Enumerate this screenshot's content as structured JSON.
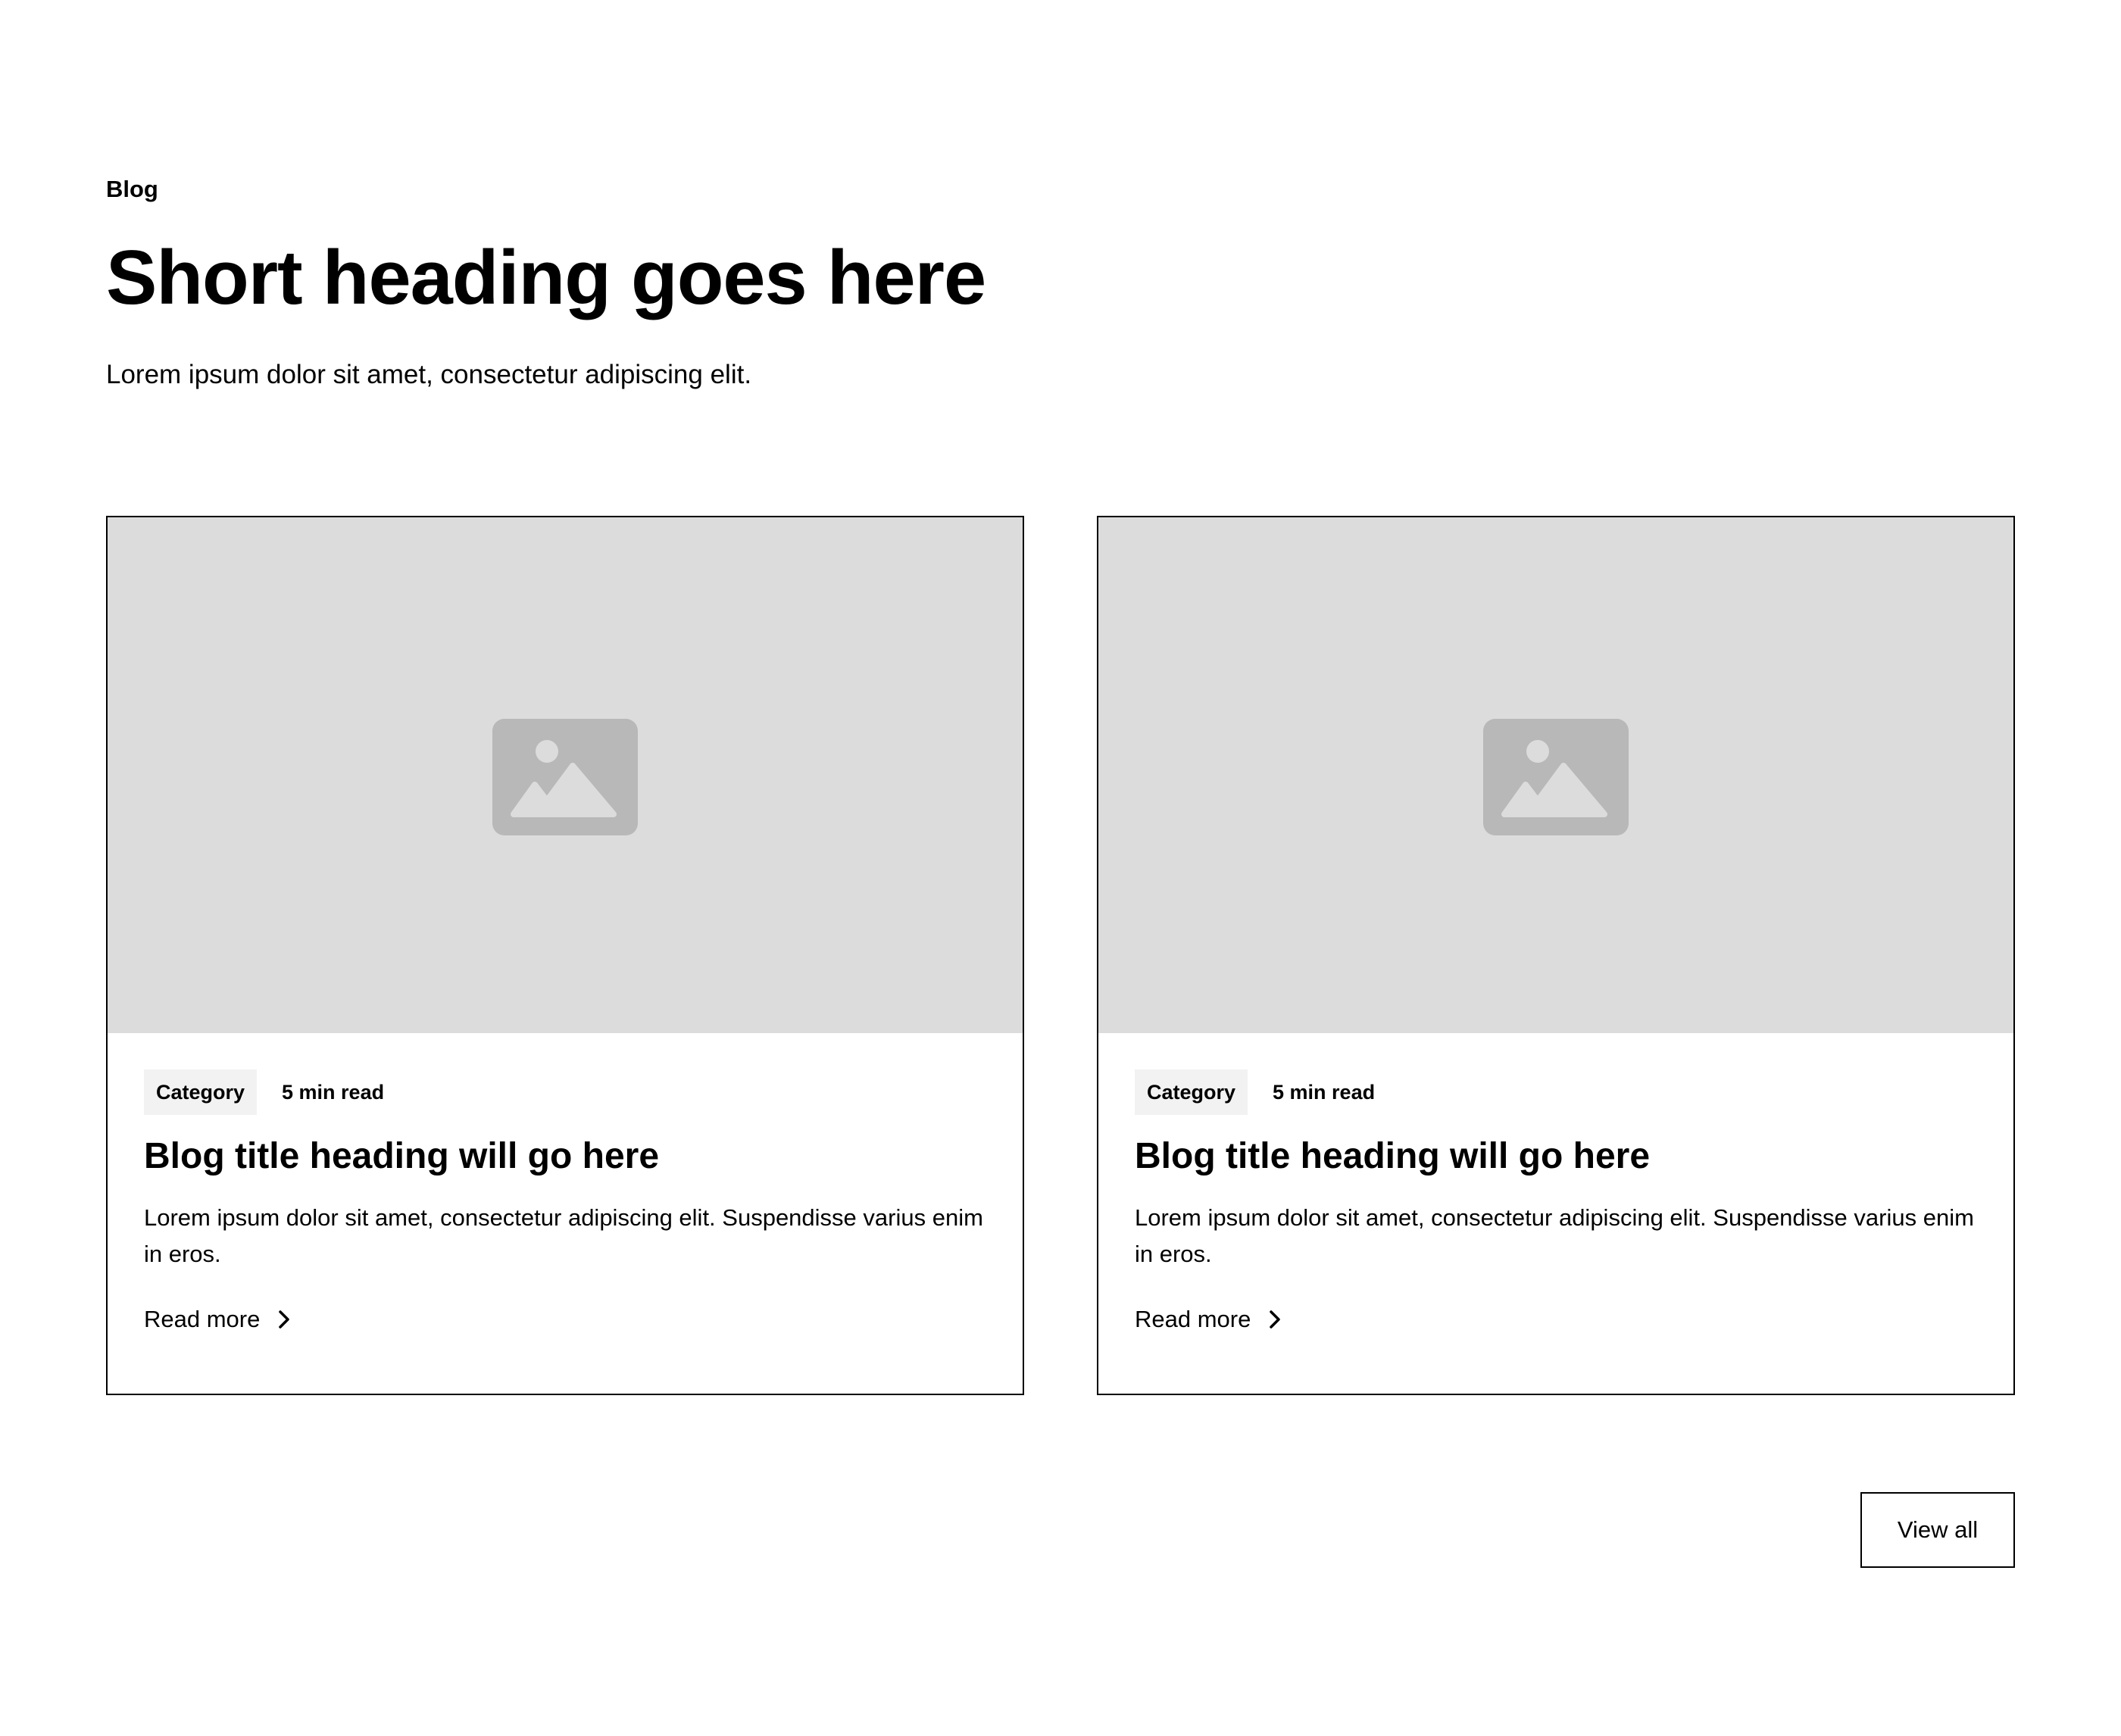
{
  "header": {
    "tagline": "Blog",
    "heading": "Short heading goes here",
    "subtitle": "Lorem ipsum dolor sit amet, consectetur adipiscing elit."
  },
  "cards": [
    {
      "image_icon": "image-placeholder-icon",
      "category": "Category",
      "read_time": "5 min read",
      "title": "Blog title heading will go here",
      "text": "Lorem ipsum dolor sit amet, consectetur adipiscing elit. Suspendisse varius enim in eros.",
      "link_label": "Read more",
      "link_icon": "chevron-right-icon"
    },
    {
      "image_icon": "image-placeholder-icon",
      "category": "Category",
      "read_time": "5 min read",
      "title": "Blog title heading will go here",
      "text": "Lorem ipsum dolor sit amet, consectetur adipiscing elit. Suspendisse varius enim in eros.",
      "link_label": "Read more",
      "link_icon": "chevron-right-icon"
    }
  ],
  "actions": {
    "view_all_label": "View all"
  },
  "colors": {
    "text": "#000000",
    "background": "#ffffff",
    "image_placeholder": "#dcdcdc",
    "icon_placeholder": "#b8b8b8",
    "badge_background": "#f2f2f2"
  }
}
